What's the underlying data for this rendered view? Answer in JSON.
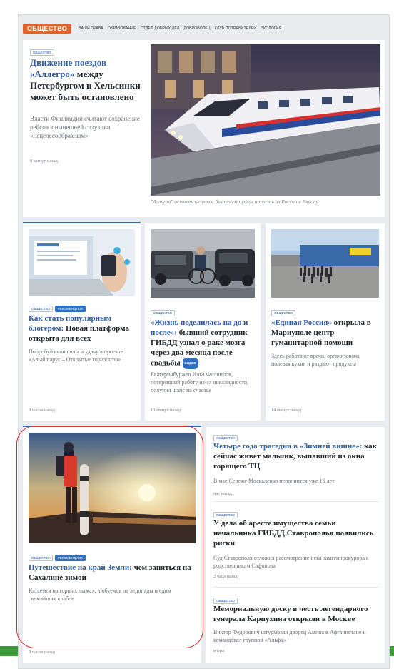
{
  "nav": {
    "main": "ОБЩЕСТВО",
    "links": [
      "ВАШИ ПРАВА",
      "ОБРАЗОВАНИЕ",
      "ОТДЕЛ ДОБРЫХ ДЕЛ",
      "ДОБРОВОЛЕЦ",
      "КЛУБ ПОТРЕБИТЕЛЕЙ",
      "ЭКОЛОГИЯ"
    ]
  },
  "lead": {
    "tag": "ОБЩЕСТВО",
    "title_hl": "Движение поездов «Аллегро»",
    "title_rest": " между Петербургом и Хельсинки может быть остановлено",
    "desc": "Власти Финляндии считают сохранение рейсов в нынешней ситуации «нецелесообразным»",
    "time": "9 минут назад",
    "caption": "\"Аллегро\" остается самым быстрым путем попасть из России в Европу."
  },
  "cards": [
    {
      "tags": [
        "ОБЩЕСТВО",
        "РЕКОМЕНДУЕМ"
      ],
      "title_hl": "Как стать популярным блогером:",
      "title_rest": " Новая платформа открыта для всех",
      "desc": "Попробуй свои силы и удачу в проекте «Алый парус – Открытые горизонты»",
      "time": "8 часов назад"
    },
    {
      "tags": [
        "ОБЩЕСТВО"
      ],
      "title_hl": "«Жизнь поделилась на до и после»:",
      "title_rest": " бывший сотрудник ГИБДД узнал о раке мозга через два месяца после свадьбы",
      "badge": "ВИДЕО",
      "desc": "Екатеринбуржец Илья Филиппов, потерявший работу из-за инвалидности, получил шанс на счастье",
      "time": "13 минут назад"
    },
    {
      "tags": [
        "ОБЩЕСТВО"
      ],
      "title_hl": "«Единая Россия»",
      "title_rest": " открыла в Мариуполе центр гуманитарной помощи",
      "desc": "Здесь работают врачи, организована полевая кухня и раздают продукты",
      "time": "14 минут назад"
    }
  ],
  "feature": {
    "tags": [
      "ОБЩЕСТВО",
      "РЕКОМЕНДУЕМ"
    ],
    "title_hl": "Путешествие на край Земли:",
    "title_rest": " чем заняться на Сахалине зимой",
    "desc": "Катаемся на горных лыжах, любуемся на ледопады и едим свежайших крабов",
    "time": "8 часов назад"
  },
  "list": [
    {
      "tag": "ОБЩЕСТВО",
      "title_hl": "Четыре года трагедии в «Зимней вишне»:",
      "title_rest": " как сейчас живет мальчик, выпавший из окна горящего ТЦ",
      "desc": "В мае Сереже Москаленко исполнится уже 16 лет",
      "time": "час назад"
    },
    {
      "tag": "ОБЩЕСТВО",
      "title_hl": "",
      "title_rest": "У дела об аресте имущества семьи начальника ГИБДД Ставрополья появились риски",
      "desc": "Суд Ставрополя отложил рассмотрение иска замгенпрокурора к родственникам Сафонова",
      "time": "2 часа назад"
    },
    {
      "tag": "ОБЩЕСТВО",
      "title_hl": "",
      "title_rest": "Мемориальную доску в честь легендарного генерала Карпухина открыли в Москве",
      "desc": "Виктор Федорович штурмовал дворец Амина в Афганистане и командовал группой «Альфа»",
      "time": "вчера"
    }
  ],
  "colors": {
    "accent_orange": "#e0642a",
    "link_blue": "#2a5aa0",
    "tag_blue": "#2f6fbf",
    "annotation_red": "#d42a2a",
    "bottom_green": "#3e9a3b"
  }
}
